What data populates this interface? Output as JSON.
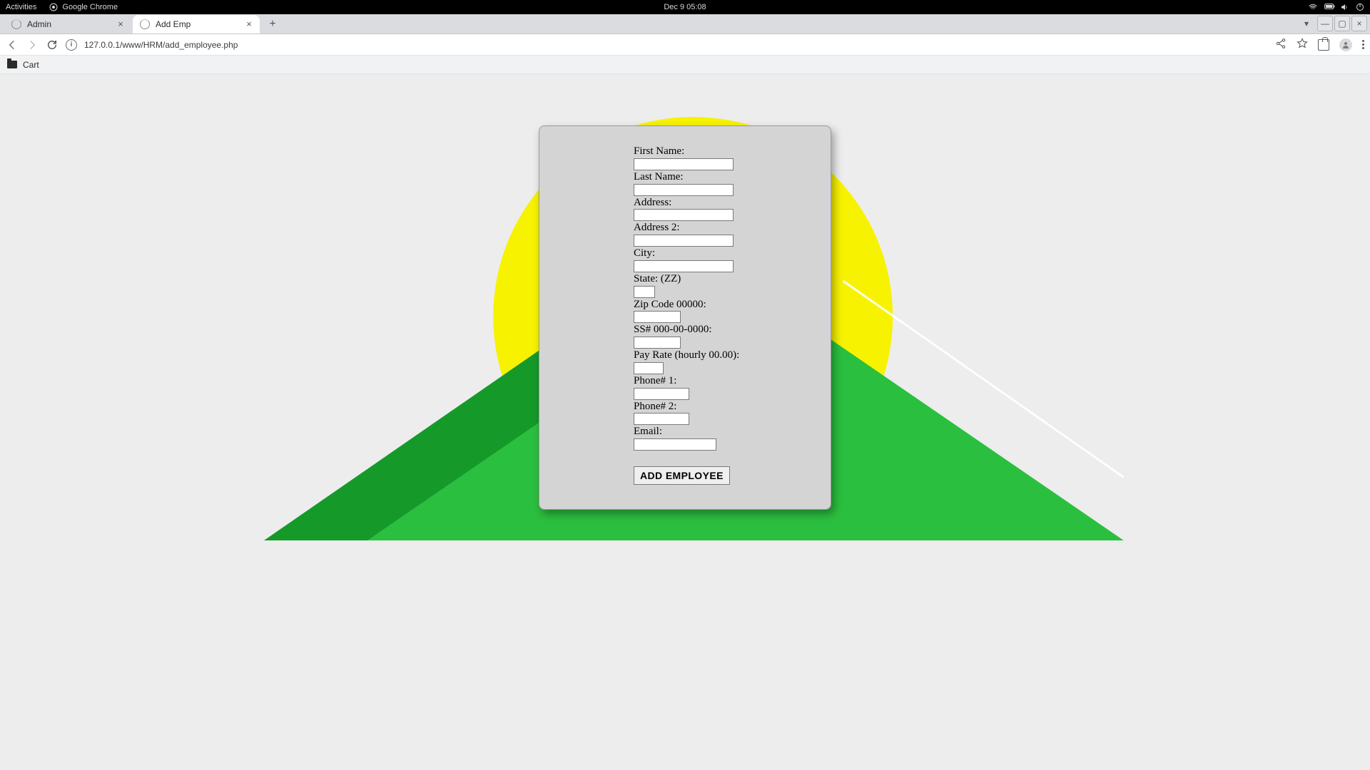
{
  "os": {
    "activities": "Activities",
    "app_name": "Google Chrome",
    "clock": "Dec 9  05:08"
  },
  "browser": {
    "tabs": [
      {
        "title": "Admin",
        "active": false
      },
      {
        "title": "Add Emp",
        "active": true
      }
    ],
    "url": "127.0.0.1/www/HRM/add_employee.php",
    "bookmarks": [
      {
        "label": "Cart"
      }
    ]
  },
  "form": {
    "first_name_label": "First Name:",
    "last_name_label": "Last Name:",
    "address_label": "Address:",
    "address2_label": "Address 2:",
    "city_label": "City:",
    "state_label": "State: (ZZ)",
    "zip_label": "Zip Code 00000:",
    "ssn_label": "SS# 000-00-0000:",
    "pay_rate_label": "Pay Rate (hourly 00.00):",
    "phone1_label": "Phone# 1:",
    "phone2_label": "Phone# 2:",
    "email_label": "Email:",
    "submit_label": "ADD EMPLOYEE",
    "values": {
      "first_name": "",
      "last_name": "",
      "address": "",
      "address2": "",
      "city": "",
      "state": "",
      "zip": "",
      "ssn": "",
      "pay_rate": "",
      "phone1": "",
      "phone2": "",
      "email": ""
    }
  }
}
